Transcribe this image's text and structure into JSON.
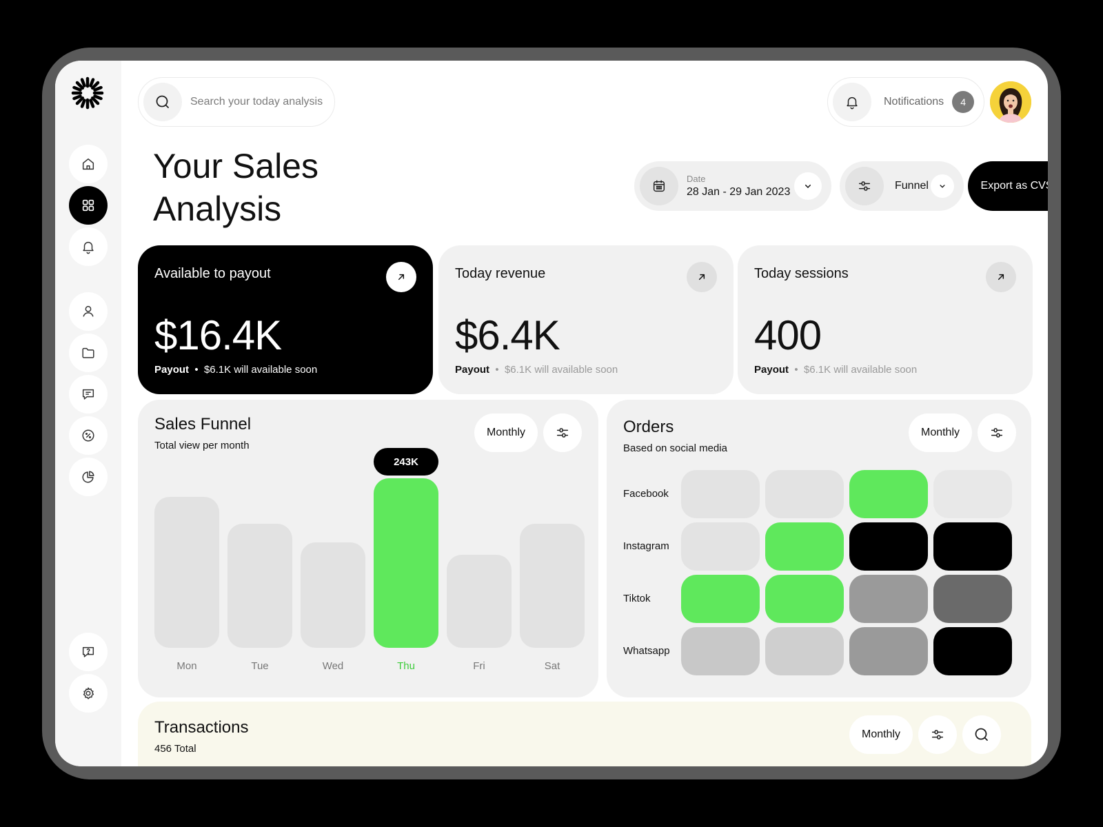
{
  "search": {
    "placeholder": "Search your today analysis"
  },
  "notifications": {
    "label": "Notifications",
    "count": "4"
  },
  "page": {
    "title": "Your Sales Analysis"
  },
  "filters": {
    "date_label": "Date",
    "date_value": "28 Jan - 29 Jan 2023",
    "funnel_label": "Funnel",
    "export_label": "Export as CVS"
  },
  "stats": [
    {
      "title": "Available to payout",
      "value": "$16.4K",
      "foot_strong": "Payout",
      "foot_text": "$6.1K will available soon"
    },
    {
      "title": "Today revenue",
      "value": "$6.4K",
      "foot_strong": "Payout",
      "foot_text": "$6.1K will available soon"
    },
    {
      "title": "Today sessions",
      "value": "400",
      "foot_strong": "Payout",
      "foot_text": "$6.1K will available soon"
    }
  ],
  "funnel": {
    "title": "Sales Funnel",
    "subtitle": "Total view per month",
    "period": "Monthly",
    "tooltip": "243K"
  },
  "chart_data": {
    "type": "bar",
    "categories": [
      "Mon",
      "Tue",
      "Wed",
      "Thu",
      "Fri",
      "Sat"
    ],
    "values": [
      0.73,
      0.6,
      0.51,
      0.82,
      0.45,
      0.6
    ],
    "highlight_index": 3,
    "highlight_label": "243K",
    "value_scale": "relative heights (no axis shown)"
  },
  "orders": {
    "title": "Orders",
    "subtitle": "Based on social media",
    "period": "Monthly",
    "rows": [
      {
        "label": "Facebook",
        "cells": [
          "#e3e3e3",
          "#e3e3e3",
          "#5fe85c",
          "#e8e8e8"
        ]
      },
      {
        "label": "Instagram",
        "cells": [
          "#e3e3e3",
          "#5fe85c",
          "#000000",
          "#000000"
        ]
      },
      {
        "label": "Tiktok",
        "cells": [
          "#5fe85c",
          "#5fe85c",
          "#9a9a9a",
          "#6a6a6a"
        ]
      },
      {
        "label": "Whatsapp",
        "cells": [
          "#c8c8c8",
          "#cfcfcf",
          "#9a9a9a",
          "#000000"
        ]
      }
    ]
  },
  "transactions": {
    "title": "Transactions",
    "subtitle": "456 Total",
    "period": "Monthly"
  },
  "colors": {
    "accent": "#5fe85c",
    "dark": "#000000",
    "card": "#f1f1f1",
    "transactions_bg": "#f9f8ec"
  }
}
